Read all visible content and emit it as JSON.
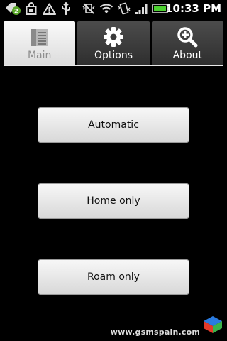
{
  "status_bar": {
    "time": "10:33 PM",
    "notification_count": "2",
    "battery_level": 1.0,
    "icons": [
      "notification-badge-icon",
      "shopping-bag-icon",
      "warning-icon",
      "usb-icon",
      "vibrate-off-icon",
      "wifi-icon",
      "phone-vibrate-icon",
      "signal-icon",
      "battery-icon"
    ]
  },
  "tabs": [
    {
      "label": "Main",
      "icon": "document-list-icon",
      "selected": true
    },
    {
      "label": "Options",
      "icon": "gear-icon",
      "selected": false
    },
    {
      "label": "About",
      "icon": "magnifier-icon",
      "selected": false
    }
  ],
  "buttons": {
    "automatic": "Automatic",
    "home_only": "Home only",
    "roam_only": "Roam only"
  },
  "watermark": {
    "text": "www.gsmspain.com"
  },
  "colors": {
    "background": "#000000",
    "tab_selected": "#f0f0f0",
    "tab_unselected": "#3a3a3a",
    "battery_green": "#4cd030"
  }
}
